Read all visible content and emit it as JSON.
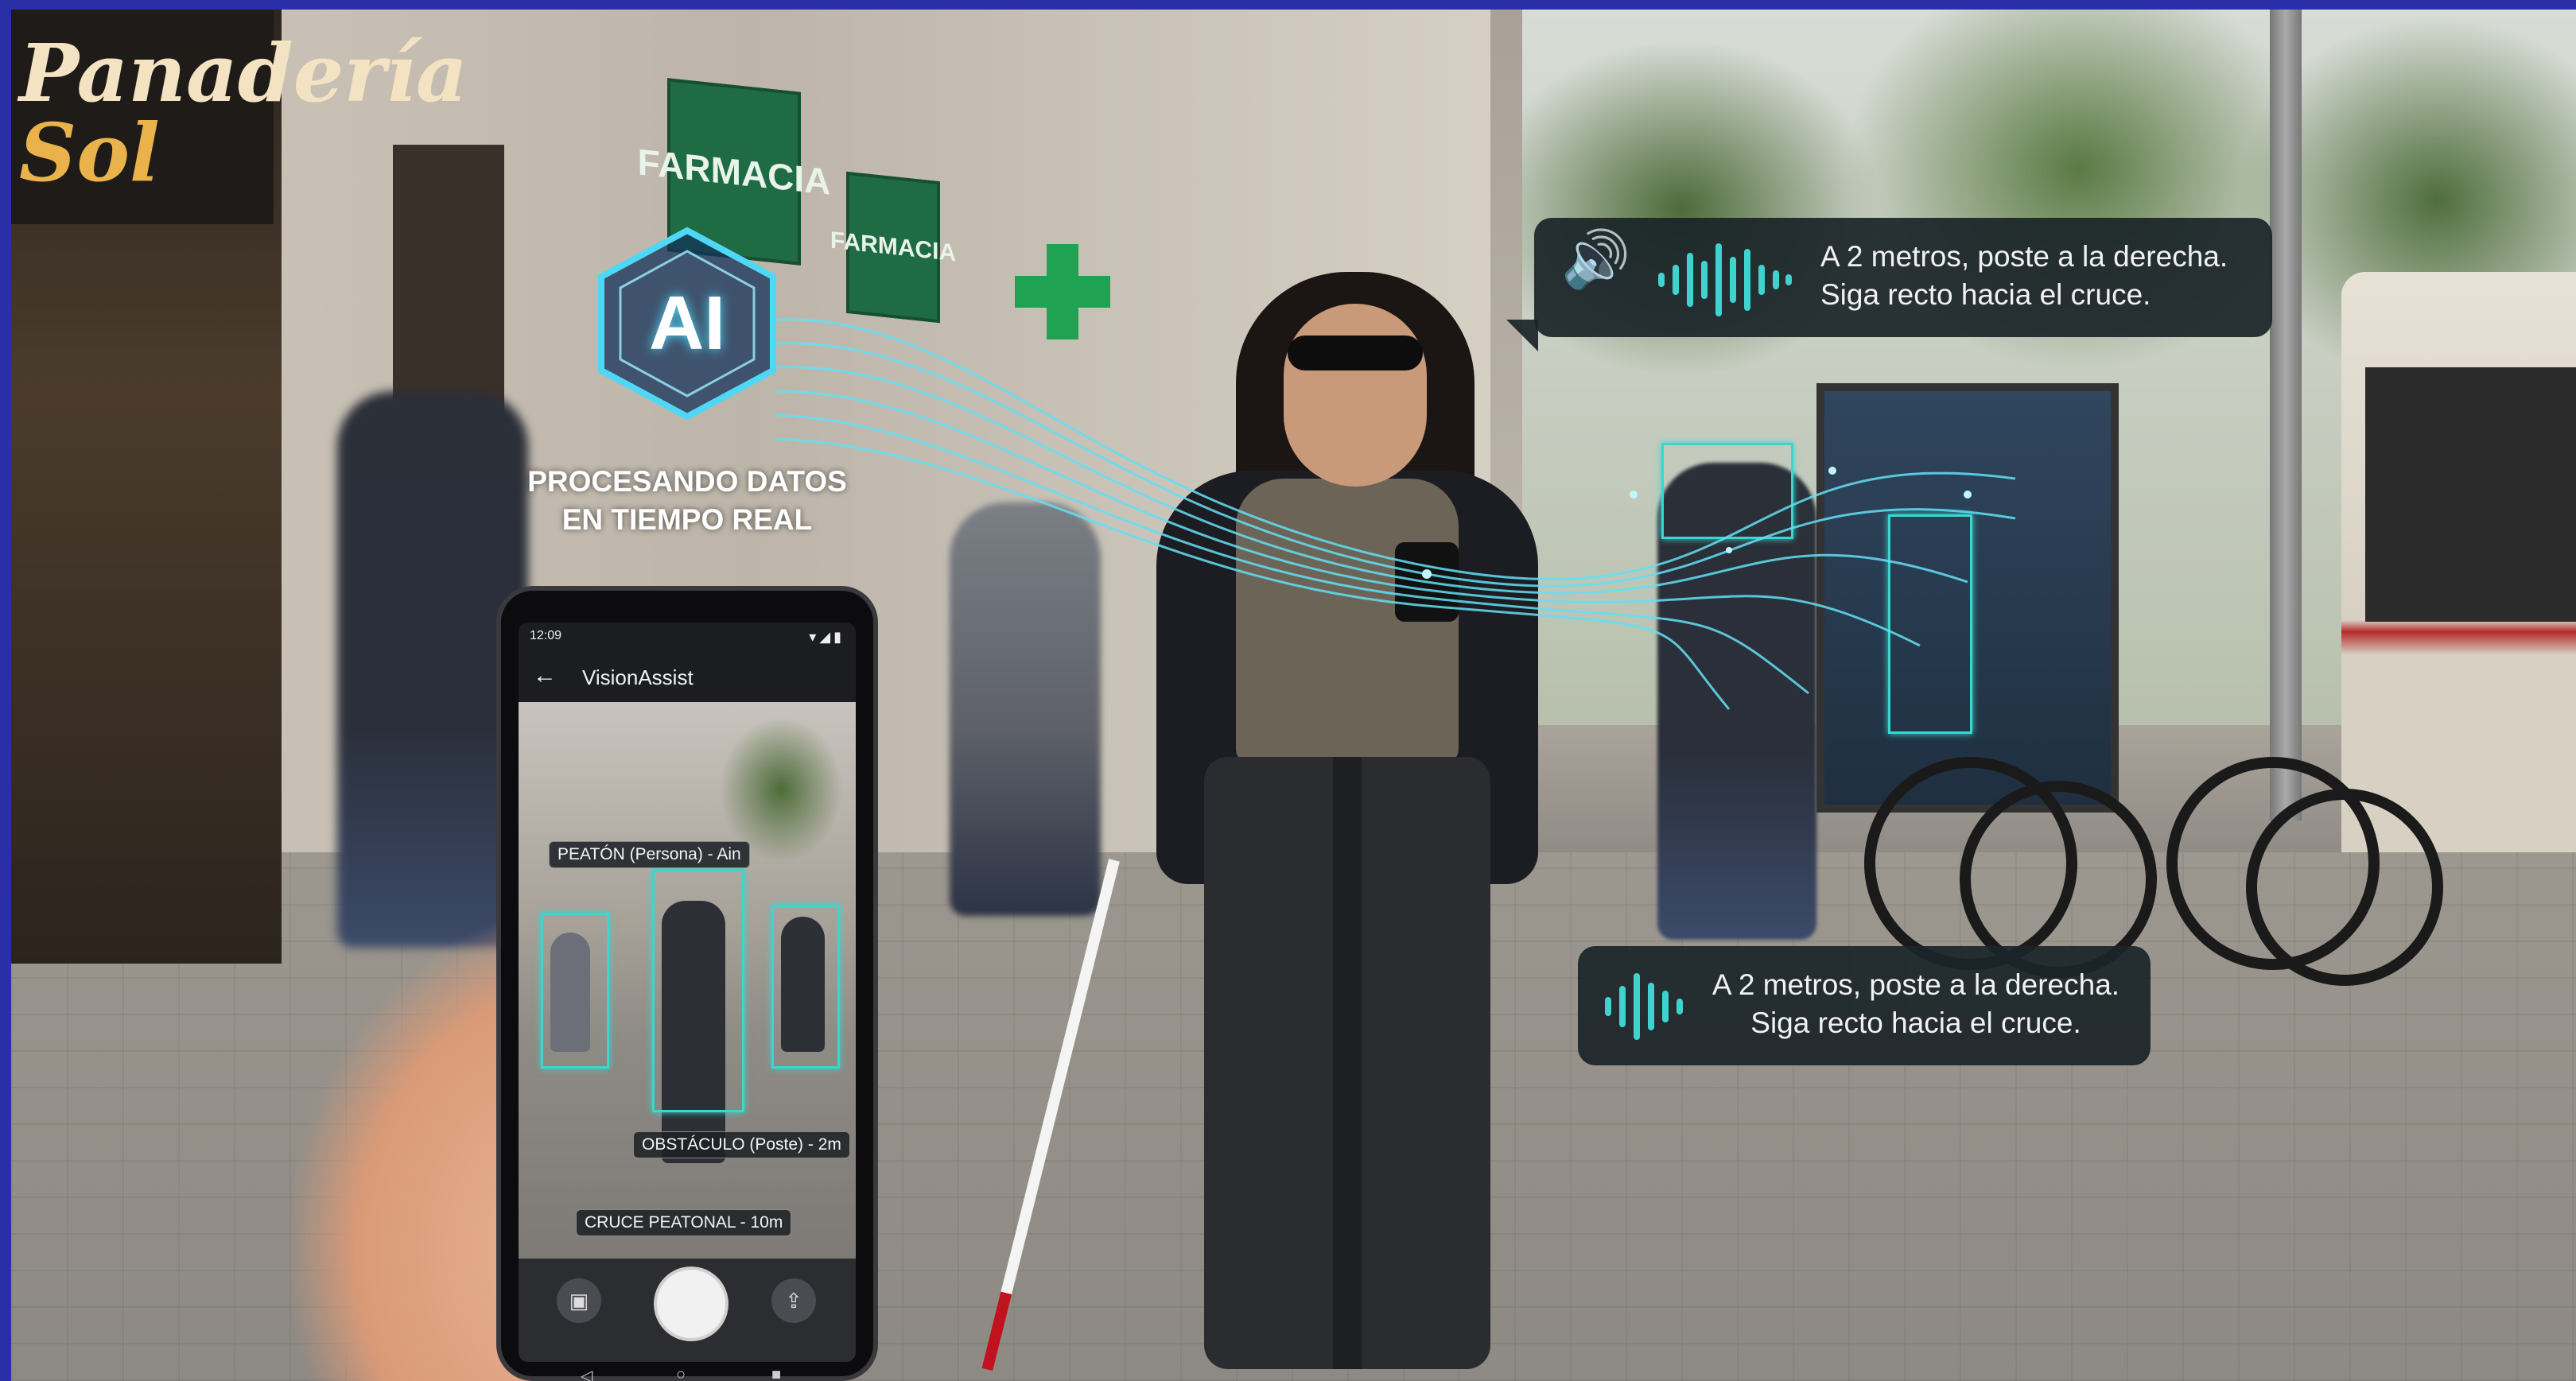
{
  "storefront": {
    "bakery_sign_word1": "Panadería",
    "bakery_sign_word2": "Sol",
    "pharmacy_sign_1": "FARMACIA",
    "pharmacy_sign_2": "FARMACIA"
  },
  "ai_badge": {
    "label": "AI",
    "caption_line1": "PROCESANDO DATOS",
    "caption_line2": "EN TIEMPO REAL"
  },
  "phone": {
    "status_time": "12:09",
    "status_icons": "▾◢▮",
    "app_title": "VisionAssist",
    "detections": [
      {
        "label": "PEATÓN (Persona) - Ain"
      },
      {
        "label": "OBSTÁCULO (Poste) - 2m"
      },
      {
        "label": "CRUCE PEATONAL - 10m"
      }
    ],
    "nav": {
      "back": "◁",
      "home": "○",
      "recent": "■"
    }
  },
  "audio_feedback": {
    "top_line1": "A 2 metros, poste a la derecha.",
    "top_line2": "Siga recto hacia el cruce.",
    "bottom_line1": "A 2 metros, poste a la derecha.",
    "bottom_line2": "Siga recto hacia el cruce."
  },
  "colors": {
    "frame_border": "#2a2fa8",
    "ai_glow": "#36c8e8",
    "detection_box": "#3ad6d0",
    "bubble_bg": "#1a2428",
    "pharmacy_green": "#1f6b43"
  },
  "icons": [
    "ai-hexagon-icon",
    "speaker-icon",
    "sound-wave-icon",
    "back-arrow-icon",
    "gallery-icon",
    "share-icon"
  ]
}
